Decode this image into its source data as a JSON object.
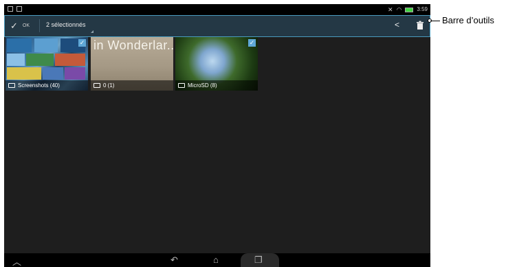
{
  "status_bar": {
    "time": "3:59",
    "left_icons": [
      "notification-icon",
      "screenshot-icon"
    ],
    "right_icons": [
      "mute-icon",
      "wifi-icon",
      "battery-icon"
    ]
  },
  "action_bar": {
    "ok_label": "OK",
    "selection_label": "2 sélectionnés",
    "share_icon": "share-icon",
    "delete_icon": "trash-icon"
  },
  "albums": [
    {
      "label": "Screenshots (40)",
      "selected": true
    },
    {
      "label": "0 (1)",
      "selected": false,
      "overlay_text": "in Wonderlar.."
    },
    {
      "label": "MicroSD (8)",
      "selected": true
    }
  ],
  "nav_bar": {
    "icons": [
      "up-icon",
      "back-icon",
      "home-icon",
      "recent-apps-icon"
    ]
  },
  "annotation": {
    "label": "Barre d’outils"
  },
  "colors": {
    "action_bar_bg": "#243845",
    "action_bar_border": "#4a9cc0",
    "selected_check": "#5fa7d6",
    "screen_bg": "#1e1e1e"
  }
}
